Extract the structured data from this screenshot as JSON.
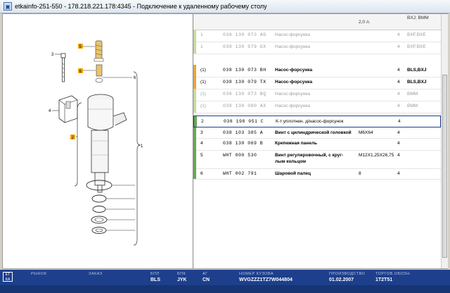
{
  "window": {
    "title": "etkainfo-251-550 - 178.218.221.178:4345 - Подключение к удаленному рабочему столу"
  },
  "header": {
    "model_col": "2,0 л.",
    "engine_col": "BXJ; BMM"
  },
  "parts": [
    {
      "pos": "1",
      "num": "038 130 073 AG",
      "name": "Насос-форсунка",
      "note": "",
      "qty": "4",
      "model": "BXF,BXE",
      "style": "grey",
      "bar": "#c8d9a0"
    },
    {
      "pos": "1",
      "num": "038 130 079 GX",
      "name": "Насос-форсунка",
      "note": "",
      "qty": "4",
      "model": "BXF,BXE",
      "style": "grey",
      "bar": "#c8d9a0"
    },
    {
      "pos": "(1)",
      "num": "038 130 073 BH",
      "name": "Насос-форсунка",
      "note": "",
      "qty": "4",
      "model": "BLS,BXJ",
      "style": "bold",
      "bar": "#e8a63a"
    },
    {
      "pos": "(1)",
      "num": "038 130 079 TX",
      "name": "Насос-форсунка",
      "note": "",
      "qty": "4",
      "model": "BLS,BXJ",
      "style": "bold",
      "bar": "#e8a63a"
    },
    {
      "pos": "(1)",
      "num": "038 130 073 BQ",
      "name": "Насос-форсунка",
      "note": "",
      "qty": "4",
      "model": "BMM",
      "style": "grey",
      "bar": "#c8d9a0"
    },
    {
      "pos": "(1)",
      "num": "038 130 080 AX",
      "name": "Насос-форсунка",
      "note": "",
      "qty": "4",
      "model": "BMM",
      "style": "grey",
      "bar": "#c8d9a0"
    },
    {
      "pos": "2",
      "num": "038 198 051 C",
      "name": "К-т уплотнен. д/насос-форсунок",
      "note": "",
      "qty": "4",
      "model": "",
      "style": "plain",
      "bar": "#6aa84f"
    },
    {
      "pos": "3",
      "num": "038 103 385 A",
      "name": "Винт с цилиндрической головкой",
      "note": "M6X64",
      "qty": "4",
      "model": "",
      "style": "bold",
      "bar": "#6aa84f"
    },
    {
      "pos": "4",
      "num": "038 130 069 B",
      "name": "Крепежная панель",
      "note": "",
      "qty": "4",
      "model": "",
      "style": "bold",
      "bar": "#6aa84f"
    },
    {
      "pos": "5",
      "num": "WHT 000 530",
      "name": "Винт регулировочный, с круг-",
      "name2": "лым кольцом",
      "note": "M12X1,25X26,75",
      "qty": "4",
      "model": "",
      "style": "bold",
      "bar": "#6aa84f"
    },
    {
      "pos": "6",
      "num": "WHT 002 791",
      "name": "Шаровой палец",
      "note": "8",
      "qty": "4",
      "model": "",
      "style": "bold",
      "bar": "#6aa84f"
    }
  ],
  "diagram": {
    "callouts": [
      "3",
      "5",
      "6",
      "6",
      "4",
      "2",
      "1"
    ]
  },
  "footer": {
    "logo": "ET KA",
    "market_label": "РЫНОК",
    "market_value": "",
    "order_label": "ЗАКАЗ",
    "order_value": "",
    "bpl_label": "БПЛ",
    "bpl_value": "BLS",
    "bpk_label": "БПК",
    "bpk_value": "JYK",
    "ag_label": "АГ",
    "ag_value": "CN",
    "vin_label": "НОМЕР КУЗОВА",
    "vin_value": "WVGZZZ1TZ7W044804",
    "prod_label": "ПРОИЗВОДСТВО",
    "prod_value": "01.02.2007",
    "trade_label": "ТОРГОВ.ОБОЗН.",
    "trade_value": "1T2T51"
  }
}
